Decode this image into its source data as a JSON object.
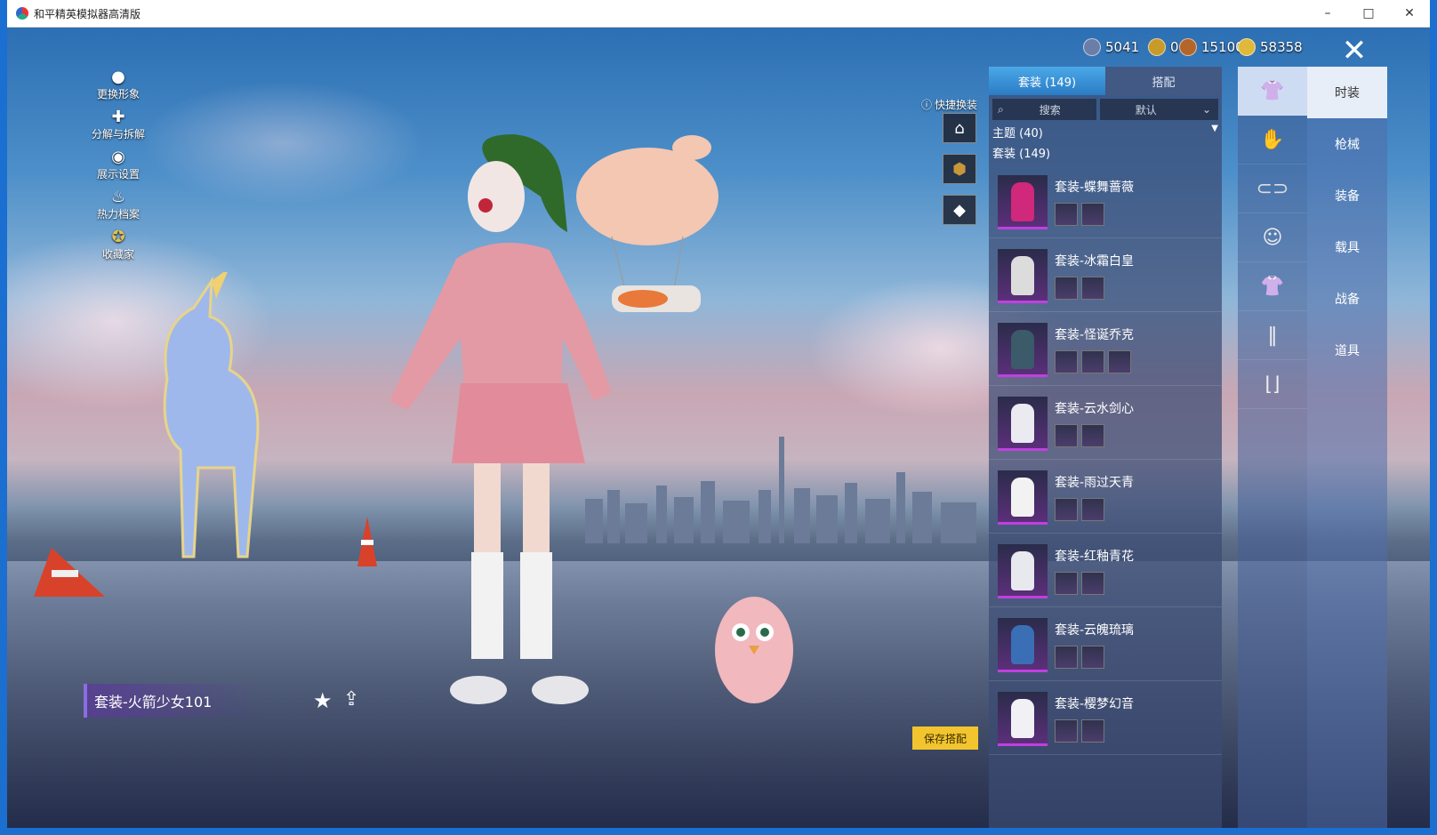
{
  "window": {
    "title": "和平精英模拟器高清版",
    "minimize": "–",
    "maximize": "□",
    "close": "✕"
  },
  "currencies": [
    {
      "value": "5041",
      "color": "#6b7ea8"
    },
    {
      "value": "0",
      "color": "#c89a2a"
    },
    {
      "value": "15100",
      "color": "#b4652a"
    },
    {
      "value": "58358",
      "color": "#e0b93a"
    }
  ],
  "left_menu": [
    {
      "label": "更换形象",
      "icon": "person-icon"
    },
    {
      "label": "分解与拆解",
      "icon": "puzzle-icon"
    },
    {
      "label": "展示设置",
      "icon": "eye-icon"
    },
    {
      "label": "热力档案",
      "icon": "flame-icon"
    },
    {
      "label": "收藏家",
      "icon": "medal-icon"
    }
  ],
  "quick_change": {
    "label": "快捷换装"
  },
  "panel": {
    "tabs": [
      "套装 (149)",
      "搭配"
    ],
    "search_placeholder": "搜索",
    "sort_value": "默认",
    "theme_section": "主题 (40)",
    "suit_section": "套装 (149)",
    "items": [
      {
        "name": "套装-蝶舞蔷薇",
        "color": "#d0287a",
        "minis": 2
      },
      {
        "name": "套装-冰霜白皇",
        "color": "#dcdcdc",
        "minis": 2
      },
      {
        "name": "套装-怪诞乔克",
        "color": "#3b5a6a",
        "minis": 3
      },
      {
        "name": "套装-云水剑心",
        "color": "#eaeaf0",
        "minis": 2
      },
      {
        "name": "套装-雨过天青",
        "color": "#f2f2f2",
        "minis": 2
      },
      {
        "name": "套装-红釉青花",
        "color": "#e8e8ef",
        "minis": 2
      },
      {
        "name": "套装-云魄琉璃",
        "color": "#3a6fb5",
        "minis": 2
      },
      {
        "name": "套装-樱梦幻音",
        "color": "#f0f0f5",
        "minis": 2
      }
    ]
  },
  "categories": [
    "top-icon",
    "glove-icon",
    "glasses-icon",
    "mask-icon",
    "jacket-icon",
    "pants-icon",
    "shoes-icon"
  ],
  "right_tabs": [
    "时装",
    "枪械",
    "装备",
    "载具",
    "战备",
    "道具"
  ],
  "outfit_name": "套装-火箭少女101",
  "save_button": "保存搭配"
}
